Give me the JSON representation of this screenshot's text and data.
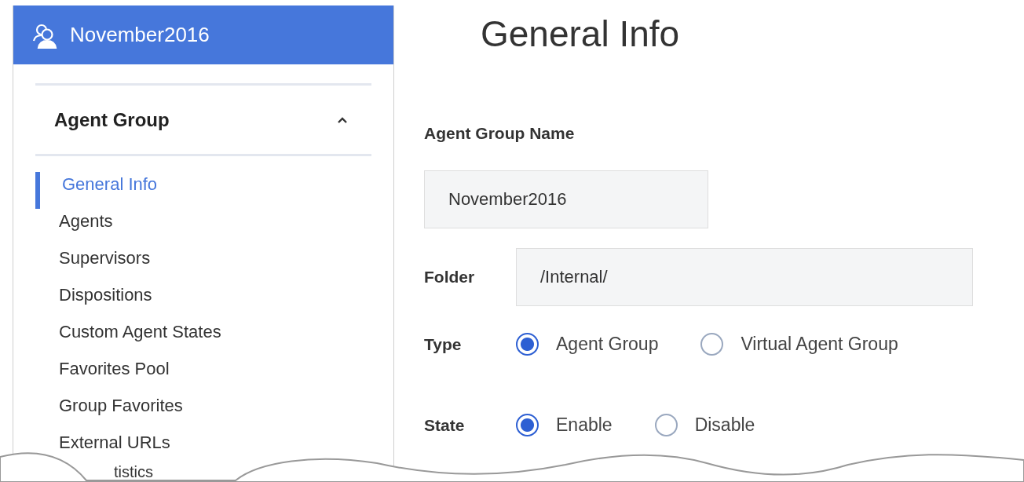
{
  "sidebar": {
    "title": "November2016",
    "section": {
      "label": "Agent Group",
      "expanded": true
    },
    "items": [
      {
        "label": "General Info",
        "selected": true
      },
      {
        "label": "Agents",
        "selected": false
      },
      {
        "label": "Supervisors",
        "selected": false
      },
      {
        "label": "Dispositions",
        "selected": false
      },
      {
        "label": "Custom Agent States",
        "selected": false
      },
      {
        "label": "Favorites Pool",
        "selected": false
      },
      {
        "label": "Group Favorites",
        "selected": false
      },
      {
        "label": "External URLs",
        "selected": false
      },
      {
        "label": "tistics",
        "selected": false
      }
    ]
  },
  "page": {
    "title": "General Info",
    "name_field": {
      "label": "Agent Group Name",
      "value": "November2016"
    },
    "folder_field": {
      "label": "Folder",
      "value": "/Internal/"
    },
    "type": {
      "label": "Type",
      "options": [
        {
          "label": "Agent Group",
          "selected": true
        },
        {
          "label": "Virtual Agent Group",
          "selected": false
        }
      ]
    },
    "state": {
      "label": "State",
      "options": [
        {
          "label": "Enable",
          "selected": true
        },
        {
          "label": "Disable",
          "selected": false
        }
      ]
    }
  }
}
